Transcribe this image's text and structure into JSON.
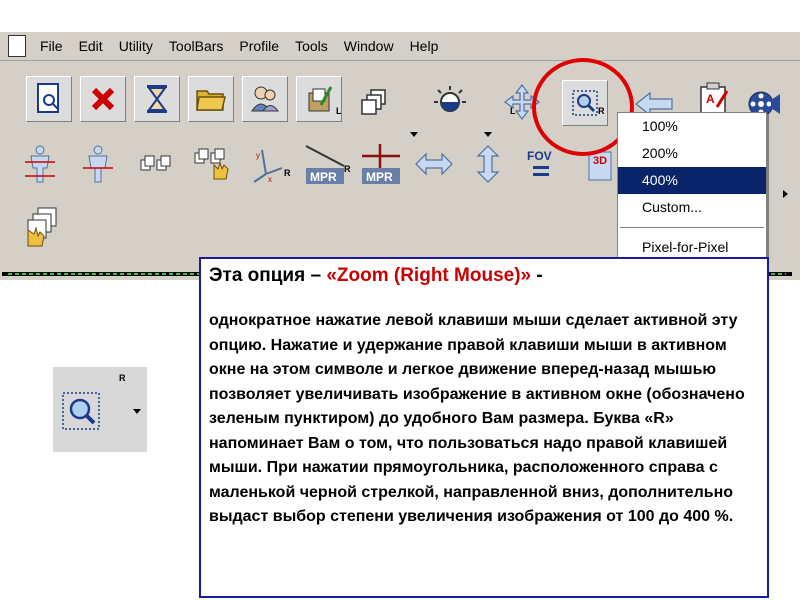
{
  "menubar": {
    "items": [
      "File",
      "Edit",
      "Utility",
      "ToolBars",
      "Profile",
      "Tools",
      "Window",
      "Help"
    ]
  },
  "toolbar": {
    "zoom_sup": "R",
    "sup_L": "L",
    "sup_R": "R",
    "fov_label": "FOV",
    "mpr_label": "MPR",
    "threed_label": "3D"
  },
  "zoom_menu": {
    "options": [
      "100%",
      "200%",
      "400%",
      "Custom...",
      "Pixel-for-Pixel"
    ],
    "selected": "400%"
  },
  "callout": {
    "title_prefix": "Эта опция – ",
    "title_highlight": "«Zoom (Right Mouse)»",
    "title_suffix": " -",
    "body": "однократное нажатие левой клавиши мыши сделает активной эту опцию. Нажатие и удержание правой клавиши мыши  в активном окне на этом символе и легкое движение вперед-назад мышью позволяет увеличивать изображение в активном окне (обозначено зеленым пунктиром) до удобного Вам размера. Буква «R» напоминает Вам о том, что пользоваться надо правой клавишей мыши. При нажатии прямоугольника, расположенного справа с маленькой черной стрелкой, направленной вниз, дополнительно выдаст выбор степени увеличения изображения  от 100 до 400 %."
  },
  "colors": {
    "accent_red": "#e00000",
    "menu_highlight": "#0a246a",
    "callout_border": "#1a1aa0"
  }
}
